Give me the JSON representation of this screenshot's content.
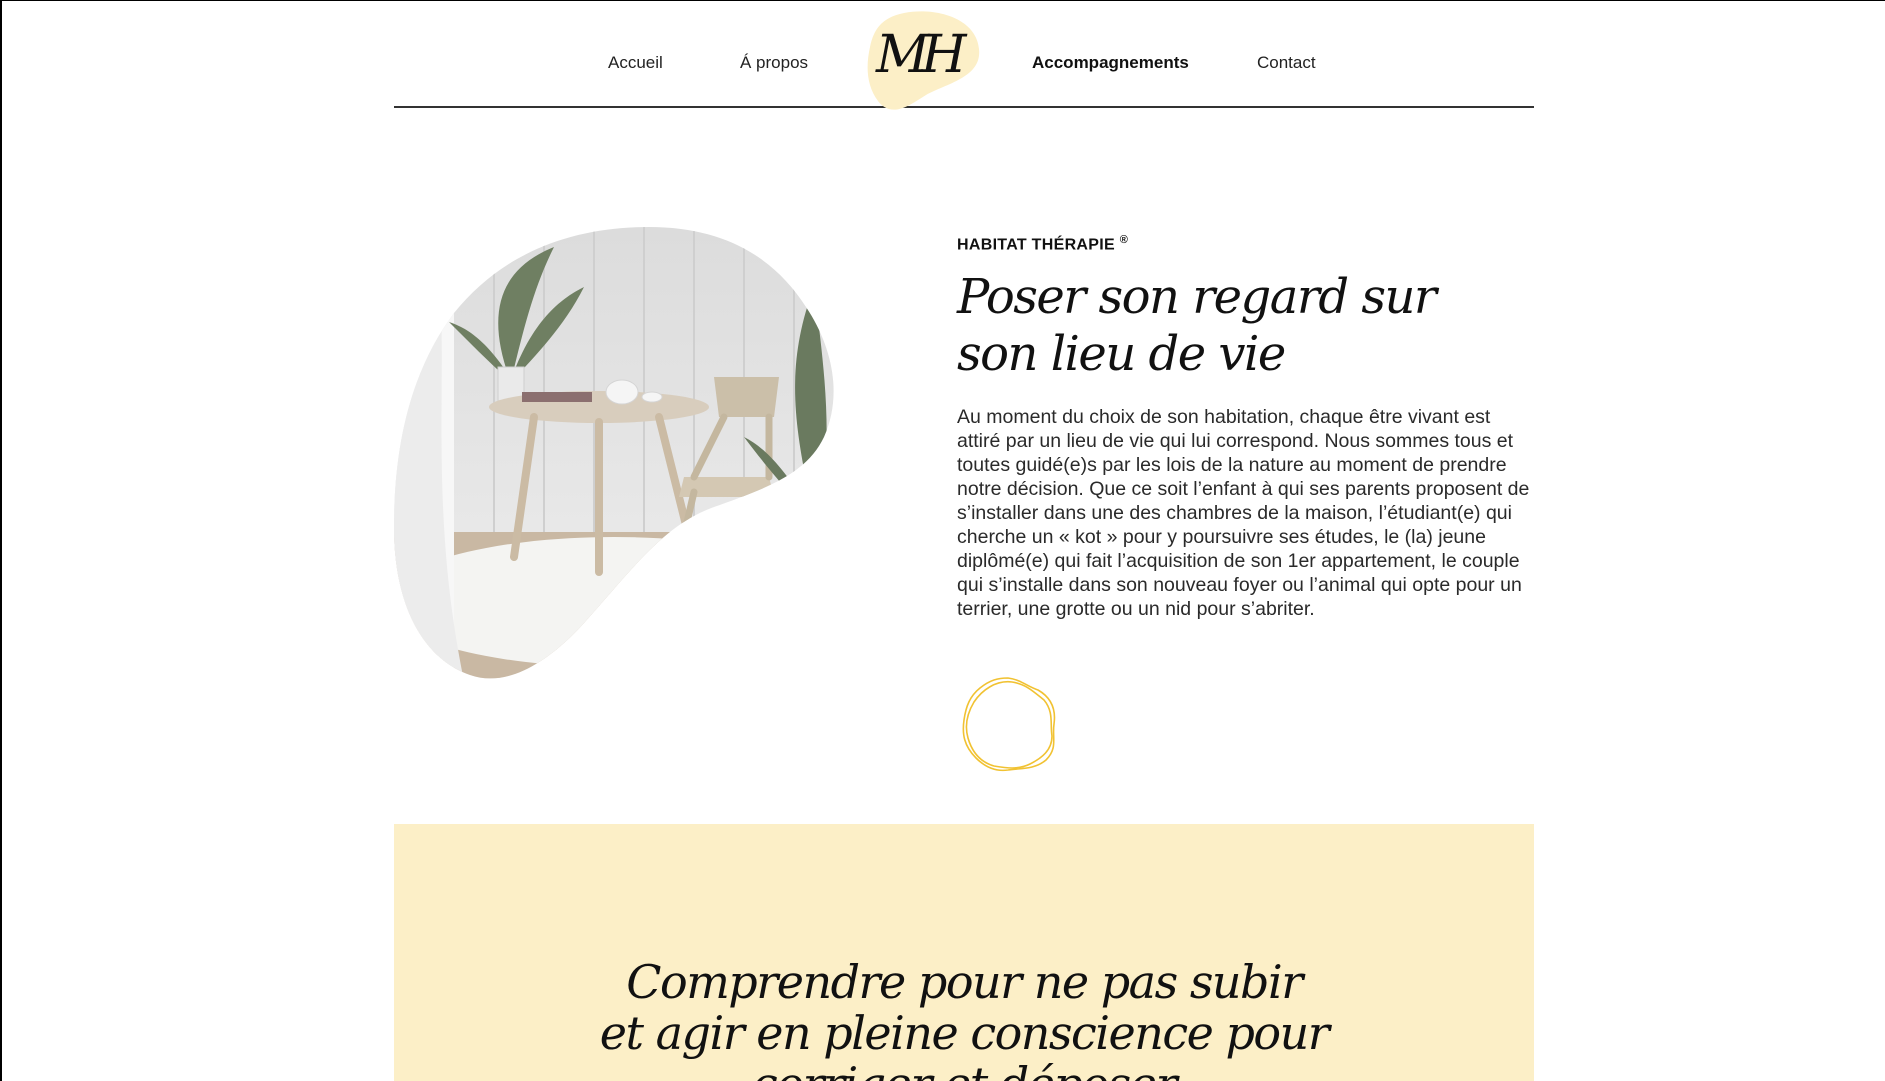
{
  "nav": {
    "items": [
      {
        "label": "Accueil",
        "active": false
      },
      {
        "label": "Á propos",
        "active": false
      },
      {
        "label": "Accompagnements",
        "active": true
      },
      {
        "label": "Contact",
        "active": false
      }
    ],
    "logo_text": "MH",
    "logo_color": "#fcefc7"
  },
  "hero": {
    "eyebrow": "HABITAT THÉRAPIE",
    "eyebrow_mark": "®",
    "headline_line1": "Poser son regard sur",
    "headline_line2": "son lieu de vie",
    "body": "Au moment du choix de son habitation, chaque être vivant est attiré par un lieu de vie qui lui correspond. Nous sommes tous et toutes guidé(e)s par les lois de la nature au moment de prendre notre décision. Que ce soit l’enfant à qui ses parents proposent de s’installer dans une des chambres de la maison, l’étudiant(e) qui cherche un « kot » pour y poursuivre ses études, le (la) jeune diplômé(e) qui fait l’acquisition de son 1er appartement, le couple qui s’installe dans son nouveau foyer ou l’animal qui opte pour un terrier, une grotte ou un nid pour s’abriter.",
    "image_icon": "interior-photo",
    "ring_icon": "ring-decoration-icon",
    "accent_color": "#f1c232"
  },
  "band": {
    "title": "Comprendre pour ne pas subir\net agir en pleine conscience pour\ncorriger et déposer",
    "background": "#fcefc7"
  }
}
